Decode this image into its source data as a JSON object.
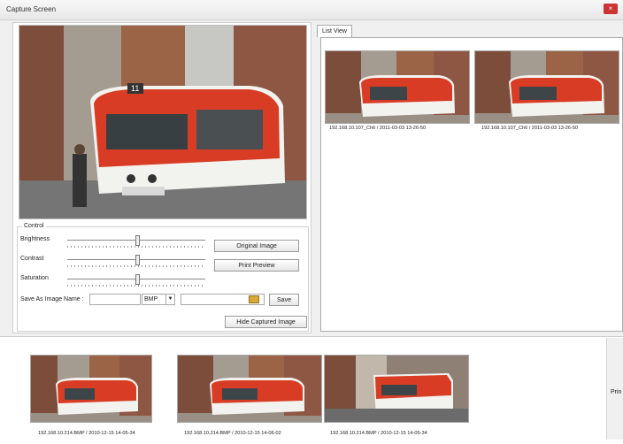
{
  "window": {
    "title": "Capture Screen",
    "close_icon": "close-icon"
  },
  "control": {
    "legend": "Control",
    "brightness_label": "Brightness",
    "contrast_label": "Contrast",
    "saturation_label": "Saturation",
    "save_as_label": "Save As Image Name :",
    "format_value": "BMP",
    "save_label": "Save",
    "original_image_label": "Original Image",
    "print_preview_label": "Print Preview",
    "hide_captured_label": "Hide Captured Image",
    "folder_icon": "folder-icon"
  },
  "list_view": {
    "tab_label": "List View",
    "items": [
      {
        "caption": "192.168.10.107_Ch6 / 2011-03-03 13-26-50"
      },
      {
        "caption": "192.168.10.107_Ch6 / 2011-03-03 13-26-50"
      }
    ]
  },
  "bottom_strip": {
    "items": [
      {
        "caption": "192.168.10.214.BMP / 2010-12-15 14-05-34"
      },
      {
        "caption": "192.168.10.214.BMP / 2010-12-15 14-06-02"
      },
      {
        "caption": "192.168.10.214.BMP / 2010-12-15 14-05-34"
      }
    ],
    "right_cut_label": "Prin"
  },
  "colors": {
    "tram_red": "#d93c24",
    "tram_white": "#f2f2ef",
    "building_brown": "#6f4a3b"
  }
}
